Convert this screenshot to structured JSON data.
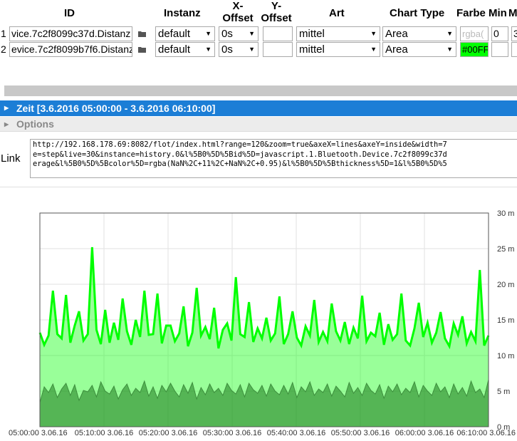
{
  "headers": {
    "id": "ID",
    "instanz": "Instanz",
    "x_offset": "X-Offset",
    "y_offset": "Y-Offset",
    "art": "Art",
    "chart_type": "Chart Type",
    "farbe": "Farbe",
    "min": "Min",
    "max_partial": "M"
  },
  "rows": [
    {
      "num": "1",
      "id": "vice.7c2f8099c37d.Distanz",
      "instanz": "default",
      "x_offset": "0s",
      "y_offset": "",
      "art": "mittel",
      "chart_type": "Area",
      "farbe": "rgba(",
      "farbe_bg": "#ffffff",
      "min": "0",
      "max": "3"
    },
    {
      "num": "2",
      "id": "evice.7c2f8099b7f6.Distanz",
      "instanz": "default",
      "x_offset": "0s",
      "y_offset": "",
      "art": "mittel",
      "chart_type": "Area",
      "farbe": "#00FF",
      "farbe_bg": "#00ff00",
      "min": "",
      "max": ""
    }
  ],
  "zeit_label": "Zeit [3.6.2016 05:00:00 - 3.6.2016 06:10:00]",
  "options_label": "Options",
  "link_label": "Link",
  "link_text": "http://192.168.178.69:8082/flot/index.html?range=120&zoom=true&axeX=lines&axeY=inside&width=7\ne=step&live=30&instance=history.0&l%5B0%5D%5Bid%5D=javascript.1.Bluetooth.Device.7c2f8099c37d\nerage&l%5B0%5D%5Bcolor%5D=rgba(NaN%2C+11%2C+NaN%2C+0.95)&l%5B0%5D%5Bthickness%5D=1&l%5B0%5D%5",
  "colors": {
    "accent_blue": "#1c7ed6",
    "series_bright": "#00ff00",
    "series_dark": "#4aa84a"
  },
  "chart_data": {
    "type": "area",
    "x_tick_labels": [
      "05:00:00 3.06.16",
      "05:10:00 3.06.16",
      "05:20:00 3.06.16",
      "05:30:00 3.06.16",
      "05:40:00 3.06.16",
      "05:50:00 3.06.16",
      "06:00:00 3.06.16",
      "06:10:00 3.06.16"
    ],
    "y_tick_labels": [
      "30 m",
      "25 m",
      "20 m",
      "15 m",
      "10 m",
      "5 m",
      "0 m"
    ],
    "y_ticks": [
      30,
      25,
      20,
      15,
      10,
      5,
      0
    ],
    "ylim": [
      0,
      30
    ],
    "x_minutes": [
      0,
      10,
      20,
      30,
      40,
      50,
      60,
      70
    ],
    "grid": true,
    "series": [
      {
        "color": "#00ff00",
        "values": [
          13.2,
          11.5,
          12.8,
          19.1,
          13.0,
          12.4,
          18.5,
          11.8,
          14.2,
          16.2,
          12.1,
          13.0,
          25.2,
          13.6,
          11.6,
          16.4,
          11.8,
          14.6,
          12.2,
          18.0,
          13.4,
          11.5,
          15.0,
          12.6,
          19.1,
          12.9,
          13.0,
          18.7,
          11.7,
          14.2,
          14.2,
          12.0,
          13.1,
          16.9,
          11.3,
          13.2,
          19.5,
          12.8,
          14.0,
          12.3,
          16.7,
          11.0,
          13.6,
          14.5,
          12.1,
          21.0,
          13.0,
          12.6,
          17.5,
          11.9,
          13.8,
          12.4,
          15.3,
          12.1,
          13.1,
          18.3,
          11.6,
          13.0,
          16.2,
          12.5,
          11.4,
          14.1,
          12.8,
          17.8,
          11.9,
          13.3,
          12.0,
          17.3,
          13.4,
          12.1,
          14.7,
          11.6,
          13.9,
          12.4,
          18.4,
          12.0,
          13.2,
          12.7,
          16.0,
          11.5,
          14.4,
          12.2,
          13.0,
          18.7,
          12.1,
          11.4,
          13.8,
          17.4,
          12.6,
          14.6,
          11.8,
          13.2,
          16.1,
          12.4,
          11.3,
          14.5,
          12.9,
          15.5,
          11.7,
          13.3,
          12.0,
          22.0,
          11.4,
          12.8
        ],
        "fill": "rgba(0,255,0,0.4)"
      },
      {
        "color": "#3d8e3d",
        "values": [
          3.4,
          5.6,
          4.8,
          6.0,
          4.1,
          5.3,
          6.1,
          4.4,
          5.9,
          3.7,
          5.1,
          4.9,
          5.8,
          4.2,
          6.3,
          5.0,
          4.6,
          5.7,
          3.9,
          5.2,
          6.0,
          4.4,
          5.4,
          4.8,
          6.4,
          4.3,
          5.6,
          4.0,
          5.8,
          4.9,
          6.1,
          5.0,
          4.2,
          5.9,
          4.7,
          6.2,
          3.9,
          5.5,
          4.5,
          6.0,
          4.8,
          5.4,
          4.4,
          6.1,
          5.1,
          4.6,
          5.9,
          4.2,
          6.1,
          5.2,
          4.7,
          5.8,
          4.3,
          6.0,
          5.0,
          4.5,
          5.8,
          4.6,
          6.2,
          4.1,
          5.6,
          4.9,
          6.3,
          4.4,
          5.3,
          4.8,
          6.0,
          4.3,
          5.7,
          5.0,
          4.2,
          6.2,
          4.7,
          5.5,
          4.4,
          6.1,
          5.1,
          4.6,
          5.9,
          4.0,
          5.7,
          4.9,
          6.0,
          4.5,
          5.4,
          4.8,
          6.3,
          4.2,
          5.8,
          5.0,
          4.4,
          6.1,
          4.9,
          5.6,
          4.1,
          6.0,
          4.6,
          5.5,
          4.3,
          6.4,
          4.8,
          5.3,
          4.1,
          6.6
        ],
        "fill": "rgba(30,120,30,0.55)"
      }
    ]
  }
}
